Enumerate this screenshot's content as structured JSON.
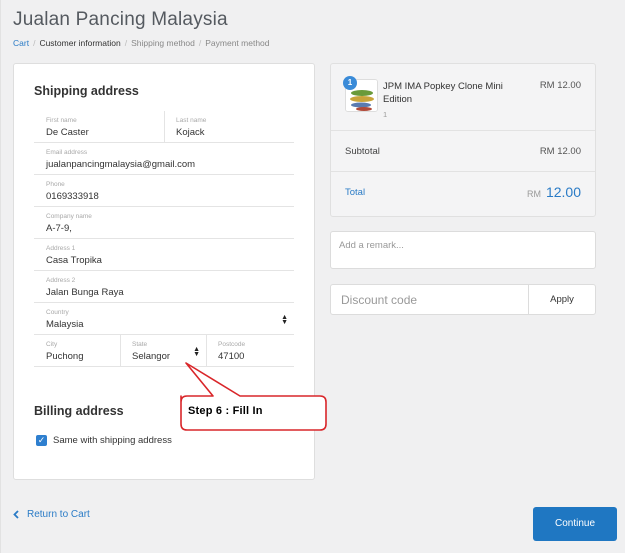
{
  "store": {
    "title": "Jualan Pancing Malaysia"
  },
  "breadcrumb": {
    "cart": "Cart",
    "sep": "/",
    "customer": "Customer information",
    "shipping": "Shipping method",
    "payment": "Payment method"
  },
  "shipping": {
    "title": "Shipping address",
    "first_name": {
      "label": "First name",
      "value": "De Caster"
    },
    "last_name": {
      "label": "Last name",
      "value": "Kojack"
    },
    "email": {
      "label": "Email address",
      "value": "jualanpancingmalaysia@gmail.com"
    },
    "phone": {
      "label": "Phone",
      "value": "0169333918"
    },
    "company": {
      "label": "Company name",
      "value": "A-7-9,"
    },
    "address1": {
      "label": "Address 1",
      "value": "Casa Tropika"
    },
    "address2": {
      "label": "Address 2",
      "value": "Jalan Bunga Raya"
    },
    "country": {
      "label": "Country",
      "value": "Malaysia"
    },
    "city": {
      "label": "City",
      "value": "Puchong"
    },
    "state": {
      "label": "State",
      "value": "Selangor"
    },
    "postcode": {
      "label": "Postcode",
      "value": "47100"
    }
  },
  "billing": {
    "title": "Billing address",
    "same_label": "Same with shipping address",
    "same_checked": true
  },
  "order": {
    "item": {
      "badge": "1",
      "name": "JPM IMA Popkey Clone Mini Edition",
      "qty": "1",
      "price": "RM 12.00"
    },
    "subtotal_label": "Subtotal",
    "subtotal_value": "RM 12.00",
    "total_label": "Total",
    "total_currency": "RM",
    "total_value": "12.00"
  },
  "remark": {
    "placeholder": "Add a remark..."
  },
  "discount": {
    "placeholder": "Discount code",
    "apply_label": "Apply"
  },
  "footer": {
    "return_label": "Return to Cart",
    "continue_label": "Continue"
  },
  "annotation": {
    "text": "Step 6 : Fill In"
  },
  "colors": {
    "accent": "#1f77c2",
    "callout_border": "#d9262a"
  }
}
